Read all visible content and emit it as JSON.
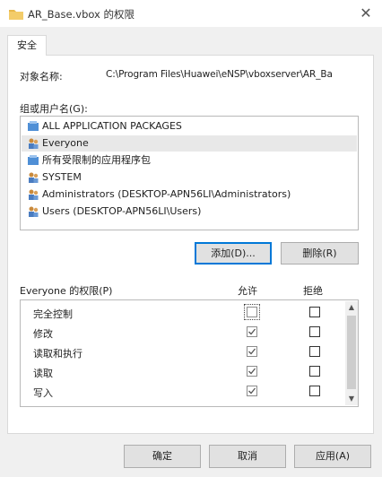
{
  "window": {
    "title": "AR_Base.vbox 的权限",
    "close_icon": "✕"
  },
  "tabs": [
    {
      "label": "安全"
    }
  ],
  "object": {
    "label": "对象名称:",
    "value": "C:\\Program Files\\Huawei\\eNSP\\vboxserver\\AR_Ba"
  },
  "groups": {
    "label": "组或用户名(G):",
    "items": [
      {
        "label": "ALL APPLICATION PACKAGES",
        "icon": "package-group-icon",
        "selected": false
      },
      {
        "label": "Everyone",
        "icon": "users-group-icon",
        "selected": true
      },
      {
        "label": "所有受限制的应用程序包",
        "icon": "package-group-icon",
        "selected": false
      },
      {
        "label": "SYSTEM",
        "icon": "users-group-icon",
        "selected": false
      },
      {
        "label": "Administrators (DESKTOP-APN56LI\\Administrators)",
        "icon": "users-group-icon",
        "selected": false
      },
      {
        "label": "Users (DESKTOP-APN56LI\\Users)",
        "icon": "users-group-icon",
        "selected": false
      }
    ]
  },
  "group_buttons": {
    "add": "添加(D)...",
    "remove": "删除(R)"
  },
  "permissions": {
    "label": "Everyone 的权限(P)",
    "allow_header": "允许",
    "deny_header": "拒绝",
    "rows": [
      {
        "name": "完全控制",
        "allow": false,
        "deny": false
      },
      {
        "name": "修改",
        "allow": true,
        "deny": false
      },
      {
        "name": "读取和执行",
        "allow": true,
        "deny": false
      },
      {
        "name": "读取",
        "allow": true,
        "deny": false
      },
      {
        "name": "写入",
        "allow": true,
        "deny": false
      }
    ]
  },
  "footer": {
    "ok": "确定",
    "cancel": "取消",
    "apply": "应用(A)"
  },
  "colors": {
    "accent": "#0078d7",
    "folder": "#e8b84a",
    "window_bg": "#f0f0f0"
  }
}
